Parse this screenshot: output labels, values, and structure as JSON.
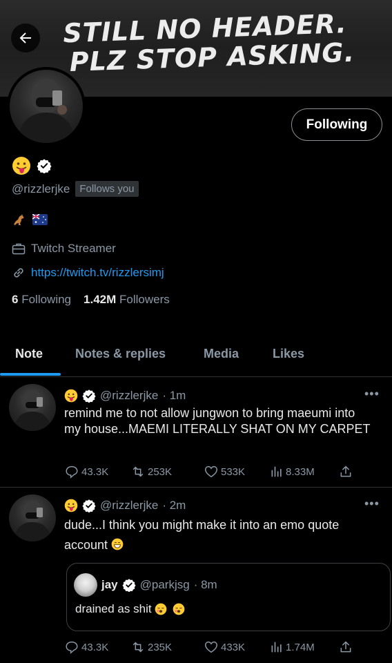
{
  "banner": {
    "line1": "STILL NO HEADER.",
    "line2": "PLZ STOP ASKING."
  },
  "profile": {
    "handle": "@rizzlerjke",
    "follows_you": "Follows you",
    "follow_button": "Following",
    "work": "Twitch Streamer",
    "link": "https://twitch.tv/rizzlersimj",
    "following_count": "6",
    "following_label": "Following",
    "followers_count": "1.42M",
    "followers_label": "Followers"
  },
  "tabs": [
    "Note",
    "Notes & replies",
    "Media",
    "Likes"
  ],
  "tweets": [
    {
      "handle": "@rizzlerjke",
      "time": "· 1m",
      "text": "remind me to not allow jungwon to bring maeumi into my house...MAEMI LITERALLY SHAT ON MY CARPET",
      "replies": "43.3K",
      "retweets": "253K",
      "likes": "533K",
      "views": "8.33M"
    },
    {
      "handle": "@rizzlerjke",
      "time": "· 2m",
      "text": "dude...I think you might make it into an emo quote account",
      "replies": "43.3K",
      "retweets": "235K",
      "likes": "433K",
      "views": "1.74M",
      "quote": {
        "name": "jay",
        "handle": "@parkjsg",
        "time": "· 8m",
        "text": "drained as shit"
      }
    }
  ],
  "colors": {
    "accent": "#1d9bf0",
    "muted": "#8b98a5",
    "text": "#e7e9ea",
    "border": "#2f3336"
  }
}
